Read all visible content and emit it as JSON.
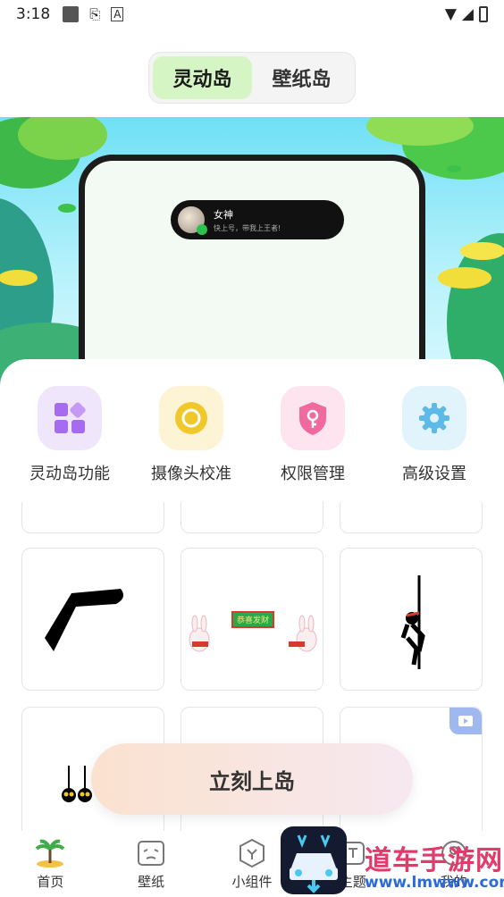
{
  "status_bar": {
    "time": "3:18"
  },
  "top_tabs": [
    {
      "label": "灵动岛",
      "active": true
    },
    {
      "label": "壁纸岛",
      "active": false
    }
  ],
  "banner": {
    "notification": {
      "name": "女神",
      "message": "快上号，带我上王者!"
    }
  },
  "features": [
    {
      "label": "灵动岛功能",
      "icon": "grid-shapes-icon",
      "color": "#a56cf0",
      "bg": "#efe6fb"
    },
    {
      "label": "摄像头校准",
      "icon": "camera-ring-icon",
      "color": "#f0c82a",
      "bg": "#fdf4d6"
    },
    {
      "label": "权限管理",
      "icon": "shield-key-icon",
      "color": "#f06aa0",
      "bg": "#fde4ee"
    },
    {
      "label": "高级设置",
      "icon": "gear-icon",
      "color": "#5cb9e8",
      "bg": "#e1f3fb"
    }
  ],
  "cards": [
    {
      "name": "boomerang-sticker",
      "caption": ""
    },
    {
      "name": "rabbit-greeting-sticker",
      "caption": "恭喜发财"
    },
    {
      "name": "climbing-figure-sticker",
      "caption": ""
    },
    {
      "name": "hanging-spiders-sticker",
      "caption": ""
    },
    {
      "name": "blank-card",
      "caption": ""
    },
    {
      "name": "video-card",
      "caption": ""
    }
  ],
  "cta": {
    "label": "立刻上岛"
  },
  "bottom_nav": [
    {
      "label": "首页",
      "icon": "palm-island-icon"
    },
    {
      "label": "壁纸",
      "icon": "wallpaper-icon"
    },
    {
      "label": "小组件",
      "icon": "widget-hex-icon"
    },
    {
      "label": "主题",
      "icon": "theme-shirt-icon"
    },
    {
      "label": "我的",
      "icon": "profile-icon"
    }
  ],
  "watermark": {
    "title": "道车手游网",
    "url": "www.lmwww.com"
  }
}
